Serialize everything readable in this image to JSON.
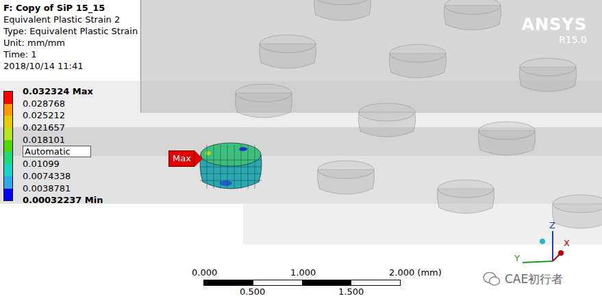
{
  "header": {
    "title": "F: Copy of SiP 15_15",
    "lines": [
      "Equivalent Plastic Strain 2",
      "Type: Equivalent Plastic Strain",
      "Unit: mm/mm",
      "Time: 1",
      "2018/10/14 11:41"
    ]
  },
  "legend": {
    "labels": [
      "0.032324 Max",
      "0.028768",
      "0.025212",
      "0.021657",
      "0.018101",
      "",
      "0.01099",
      "0.0074338",
      "0.0038781",
      "0.00032237 Min"
    ],
    "field": "Automatic",
    "bands": [
      {
        "color": "#ff0000"
      },
      {
        "color": "#ff9900"
      },
      {
        "color": "#e6cc00"
      },
      {
        "color": "#b5e61d"
      },
      {
        "color": "#4cd900"
      },
      {
        "color": "#1adb7a"
      },
      {
        "color": "#19d4c8"
      },
      {
        "color": "#2fa8f0"
      },
      {
        "color": "#0000ff"
      }
    ]
  },
  "logo": {
    "name": "ANSYS",
    "version": "R15.0"
  },
  "probe": {
    "label": "Max"
  },
  "scale_bar": {
    "top": [
      "0.000",
      "1.000",
      "2.000 (mm)"
    ],
    "bottom": [
      "0.500",
      "1.500"
    ]
  },
  "axes": {
    "z": "Z",
    "x": "X",
    "y": "Y"
  },
  "watermark": "CAE初行者"
}
